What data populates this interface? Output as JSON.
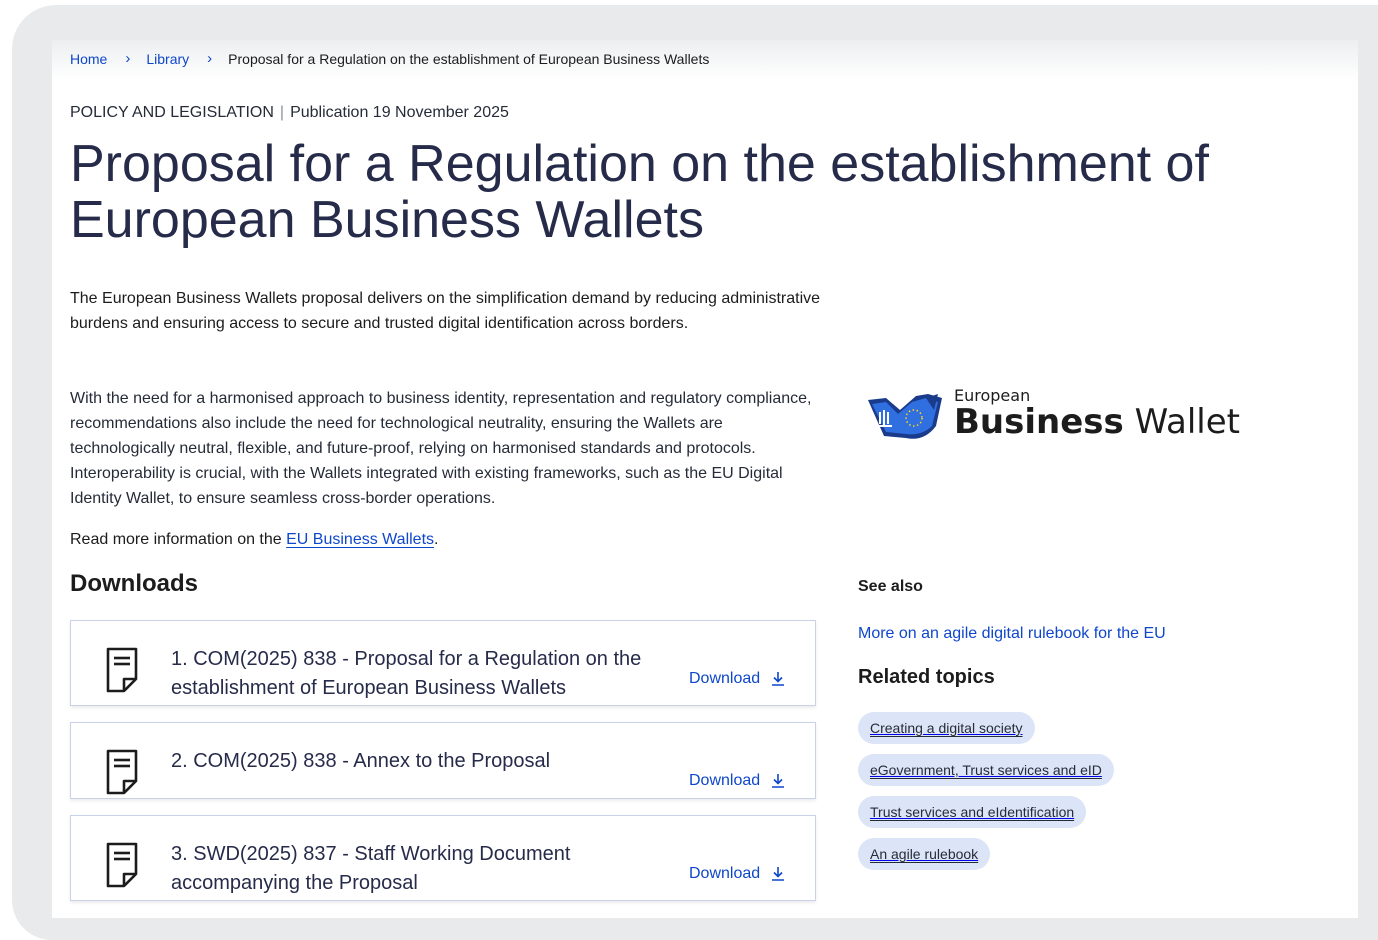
{
  "breadcrumb": {
    "home": "Home",
    "library": "Library",
    "current": "Proposal for a Regulation on the establishment of European Business Wallets"
  },
  "meta": {
    "category": "POLICY AND LEGISLATION",
    "publication": "Publication 19 November 2025"
  },
  "title": "Proposal for a Regulation on the establishment of European Business Wallets",
  "paragraphs": {
    "p1": "The European Business Wallets proposal delivers on the simplification demand by reducing administrative burdens and ensuring access to secure and trusted digital identification across borders.",
    "p2": "With the need for a harmonised approach to business identity, representation and regulatory compliance, recommendations also include the need for technological neutrality, ensuring the Wallets are technologically neutral, flexible, and future-proof, relying on harmonised standards and protocols. Interoperability is crucial, with the Wallets integrated with existing frameworks, such as the EU Digital Identity Wallet, to ensure seamless cross-border operations.",
    "p3_prefix": "Read more information on the ",
    "p3_link": "EU Business Wallets",
    "p3_suffix": "."
  },
  "downloads": {
    "heading": "Downloads",
    "items": [
      {
        "title": "1. COM(2025) 838 - Proposal for a Regulation on the establishment of European Business Wallets",
        "action": "Download"
      },
      {
        "title": "2. COM(2025) 838 - Annex to the Proposal",
        "action": "Download"
      },
      {
        "title": "3. SWD(2025) 837 - Staff Working Document accompanying the Proposal",
        "action": "Download"
      }
    ]
  },
  "logo": {
    "line1": "European",
    "line2_bold": "Business",
    "line2_regular": " Wallet",
    "colors": {
      "dark_blue": "#1a3a8c",
      "light_blue": "#2f6fe0",
      "yellow": "#ffd617"
    }
  },
  "see_also": {
    "label": "See also",
    "link": "More on an agile digital rulebook for the EU"
  },
  "related": {
    "heading": "Related topics",
    "tags": [
      "Creating a digital society",
      "eGovernment, Trust services and eID",
      "Trust services and eIdentification",
      "An agile rulebook"
    ]
  },
  "colors": {
    "link": "#0e47cb",
    "title": "#262b4a",
    "tag_bg": "#dce5f7",
    "frame": "#e9eaec"
  }
}
